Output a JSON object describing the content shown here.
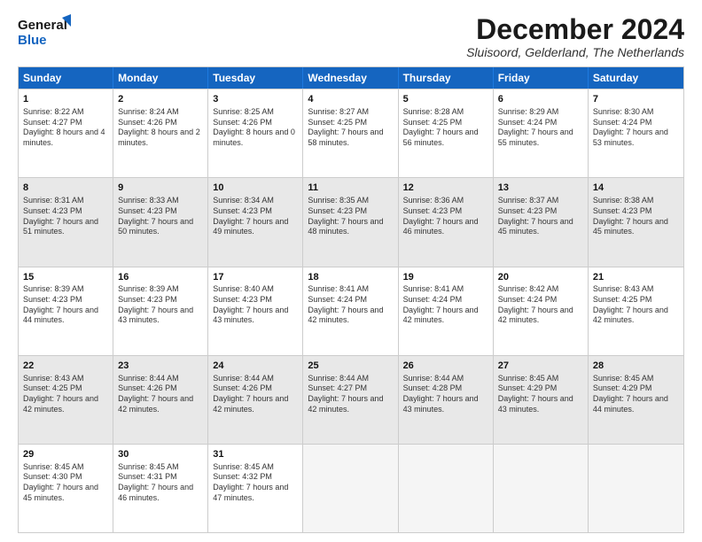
{
  "logo": {
    "general": "General",
    "blue": "Blue"
  },
  "title": "December 2024",
  "location": "Sluisoord, Gelderland, The Netherlands",
  "days": [
    "Sunday",
    "Monday",
    "Tuesday",
    "Wednesday",
    "Thursday",
    "Friday",
    "Saturday"
  ],
  "weeks": [
    [
      {
        "day": "1",
        "sunrise": "Sunrise: 8:22 AM",
        "sunset": "Sunset: 4:27 PM",
        "daylight": "Daylight: 8 hours and 4 minutes."
      },
      {
        "day": "2",
        "sunrise": "Sunrise: 8:24 AM",
        "sunset": "Sunset: 4:26 PM",
        "daylight": "Daylight: 8 hours and 2 minutes."
      },
      {
        "day": "3",
        "sunrise": "Sunrise: 8:25 AM",
        "sunset": "Sunset: 4:26 PM",
        "daylight": "Daylight: 8 hours and 0 minutes."
      },
      {
        "day": "4",
        "sunrise": "Sunrise: 8:27 AM",
        "sunset": "Sunset: 4:25 PM",
        "daylight": "Daylight: 7 hours and 58 minutes."
      },
      {
        "day": "5",
        "sunrise": "Sunrise: 8:28 AM",
        "sunset": "Sunset: 4:25 PM",
        "daylight": "Daylight: 7 hours and 56 minutes."
      },
      {
        "day": "6",
        "sunrise": "Sunrise: 8:29 AM",
        "sunset": "Sunset: 4:24 PM",
        "daylight": "Daylight: 7 hours and 55 minutes."
      },
      {
        "day": "7",
        "sunrise": "Sunrise: 8:30 AM",
        "sunset": "Sunset: 4:24 PM",
        "daylight": "Daylight: 7 hours and 53 minutes."
      }
    ],
    [
      {
        "day": "8",
        "sunrise": "Sunrise: 8:31 AM",
        "sunset": "Sunset: 4:23 PM",
        "daylight": "Daylight: 7 hours and 51 minutes."
      },
      {
        "day": "9",
        "sunrise": "Sunrise: 8:33 AM",
        "sunset": "Sunset: 4:23 PM",
        "daylight": "Daylight: 7 hours and 50 minutes."
      },
      {
        "day": "10",
        "sunrise": "Sunrise: 8:34 AM",
        "sunset": "Sunset: 4:23 PM",
        "daylight": "Daylight: 7 hours and 49 minutes."
      },
      {
        "day": "11",
        "sunrise": "Sunrise: 8:35 AM",
        "sunset": "Sunset: 4:23 PM",
        "daylight": "Daylight: 7 hours and 48 minutes."
      },
      {
        "day": "12",
        "sunrise": "Sunrise: 8:36 AM",
        "sunset": "Sunset: 4:23 PM",
        "daylight": "Daylight: 7 hours and 46 minutes."
      },
      {
        "day": "13",
        "sunrise": "Sunrise: 8:37 AM",
        "sunset": "Sunset: 4:23 PM",
        "daylight": "Daylight: 7 hours and 45 minutes."
      },
      {
        "day": "14",
        "sunrise": "Sunrise: 8:38 AM",
        "sunset": "Sunset: 4:23 PM",
        "daylight": "Daylight: 7 hours and 45 minutes."
      }
    ],
    [
      {
        "day": "15",
        "sunrise": "Sunrise: 8:39 AM",
        "sunset": "Sunset: 4:23 PM",
        "daylight": "Daylight: 7 hours and 44 minutes."
      },
      {
        "day": "16",
        "sunrise": "Sunrise: 8:39 AM",
        "sunset": "Sunset: 4:23 PM",
        "daylight": "Daylight: 7 hours and 43 minutes."
      },
      {
        "day": "17",
        "sunrise": "Sunrise: 8:40 AM",
        "sunset": "Sunset: 4:23 PM",
        "daylight": "Daylight: 7 hours and 43 minutes."
      },
      {
        "day": "18",
        "sunrise": "Sunrise: 8:41 AM",
        "sunset": "Sunset: 4:24 PM",
        "daylight": "Daylight: 7 hours and 42 minutes."
      },
      {
        "day": "19",
        "sunrise": "Sunrise: 8:41 AM",
        "sunset": "Sunset: 4:24 PM",
        "daylight": "Daylight: 7 hours and 42 minutes."
      },
      {
        "day": "20",
        "sunrise": "Sunrise: 8:42 AM",
        "sunset": "Sunset: 4:24 PM",
        "daylight": "Daylight: 7 hours and 42 minutes."
      },
      {
        "day": "21",
        "sunrise": "Sunrise: 8:43 AM",
        "sunset": "Sunset: 4:25 PM",
        "daylight": "Daylight: 7 hours and 42 minutes."
      }
    ],
    [
      {
        "day": "22",
        "sunrise": "Sunrise: 8:43 AM",
        "sunset": "Sunset: 4:25 PM",
        "daylight": "Daylight: 7 hours and 42 minutes."
      },
      {
        "day": "23",
        "sunrise": "Sunrise: 8:44 AM",
        "sunset": "Sunset: 4:26 PM",
        "daylight": "Daylight: 7 hours and 42 minutes."
      },
      {
        "day": "24",
        "sunrise": "Sunrise: 8:44 AM",
        "sunset": "Sunset: 4:26 PM",
        "daylight": "Daylight: 7 hours and 42 minutes."
      },
      {
        "day": "25",
        "sunrise": "Sunrise: 8:44 AM",
        "sunset": "Sunset: 4:27 PM",
        "daylight": "Daylight: 7 hours and 42 minutes."
      },
      {
        "day": "26",
        "sunrise": "Sunrise: 8:44 AM",
        "sunset": "Sunset: 4:28 PM",
        "daylight": "Daylight: 7 hours and 43 minutes."
      },
      {
        "day": "27",
        "sunrise": "Sunrise: 8:45 AM",
        "sunset": "Sunset: 4:29 PM",
        "daylight": "Daylight: 7 hours and 43 minutes."
      },
      {
        "day": "28",
        "sunrise": "Sunrise: 8:45 AM",
        "sunset": "Sunset: 4:29 PM",
        "daylight": "Daylight: 7 hours and 44 minutes."
      }
    ],
    [
      {
        "day": "29",
        "sunrise": "Sunrise: 8:45 AM",
        "sunset": "Sunset: 4:30 PM",
        "daylight": "Daylight: 7 hours and 45 minutes."
      },
      {
        "day": "30",
        "sunrise": "Sunrise: 8:45 AM",
        "sunset": "Sunset: 4:31 PM",
        "daylight": "Daylight: 7 hours and 46 minutes."
      },
      {
        "day": "31",
        "sunrise": "Sunrise: 8:45 AM",
        "sunset": "Sunset: 4:32 PM",
        "daylight": "Daylight: 7 hours and 47 minutes."
      },
      null,
      null,
      null,
      null
    ]
  ]
}
